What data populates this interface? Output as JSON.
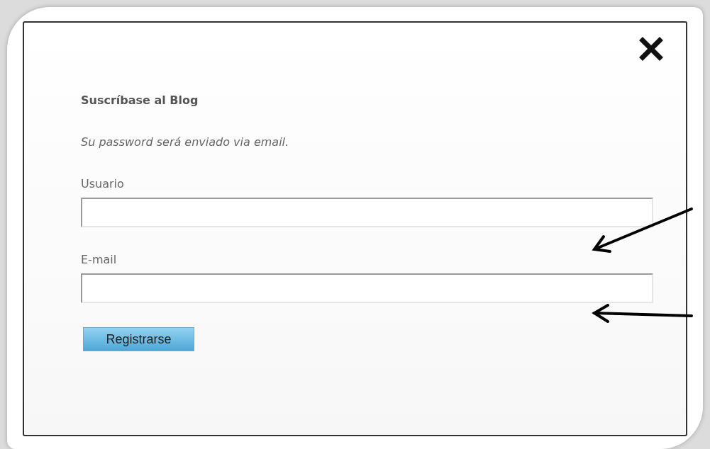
{
  "dialog": {
    "title": "Suscríbase al Blog",
    "subtitle": "Su password será enviado via email.",
    "fields": [
      {
        "label": "Usuario"
      },
      {
        "label": "E-mail"
      }
    ],
    "button": "Registrarse"
  }
}
